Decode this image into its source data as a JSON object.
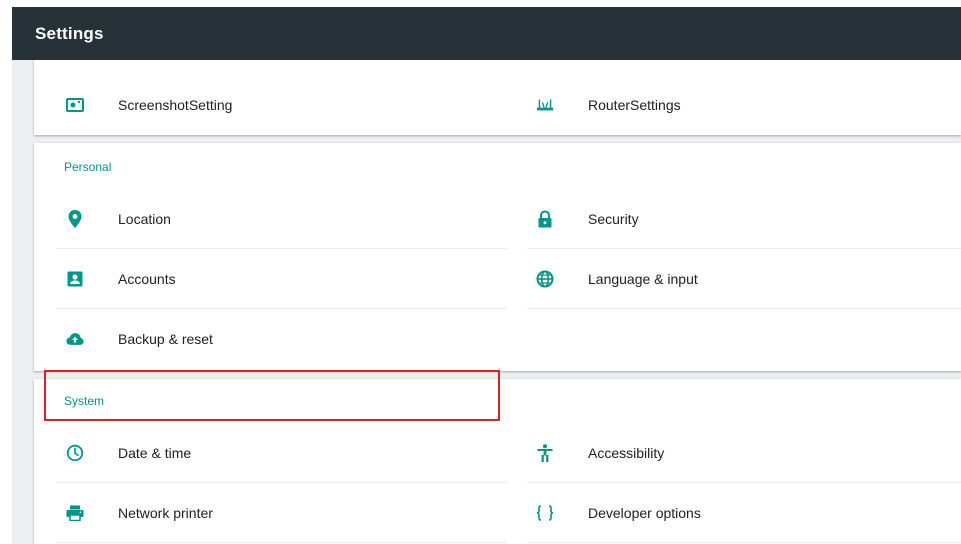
{
  "appbar": {
    "title": "Settings"
  },
  "top_items": [
    {
      "label": "ScreenshotSetting",
      "icon": "screenshot-icon"
    },
    {
      "label": "RouterSettings",
      "icon": "router-icon"
    }
  ],
  "personal": {
    "title": "Personal",
    "items": [
      {
        "label": "Location",
        "icon": "location-pin-icon"
      },
      {
        "label": "Security",
        "icon": "lock-icon"
      },
      {
        "label": "Accounts",
        "icon": "account-box-icon"
      },
      {
        "label": "Language & input",
        "icon": "globe-icon"
      },
      {
        "label": "Backup & reset",
        "icon": "cloud-upload-icon"
      }
    ]
  },
  "system": {
    "title": "System",
    "items": [
      {
        "label": "Date & time",
        "icon": "clock-icon",
        "highlighted": true
      },
      {
        "label": "Accessibility",
        "icon": "accessibility-icon"
      },
      {
        "label": "Network printer",
        "icon": "printer-icon"
      },
      {
        "label": "Developer options",
        "icon": "braces-icon"
      }
    ]
  },
  "colors": {
    "appbar": "#263238",
    "accent": "#009688",
    "background": "#eceff1",
    "highlight": "#e02020"
  }
}
